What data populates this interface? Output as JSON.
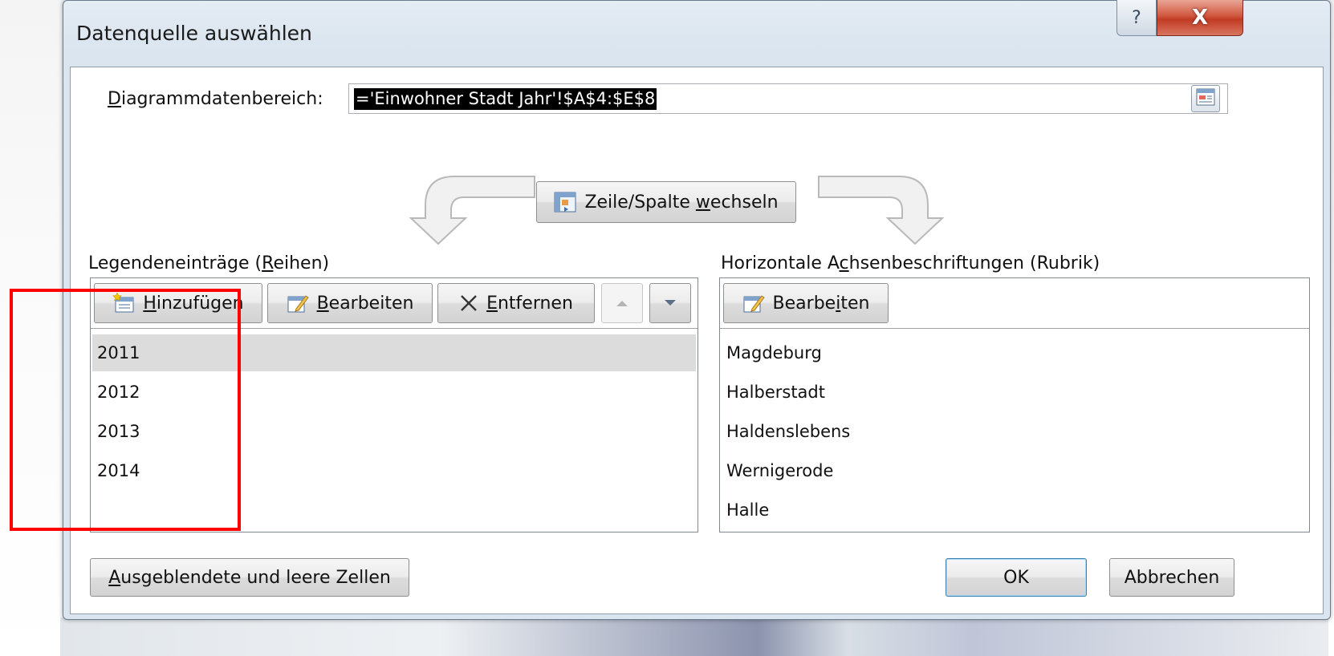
{
  "window": {
    "title": "Datenquelle auswählen",
    "help_glyph": "?",
    "close_glyph": "X"
  },
  "range": {
    "label_pre": "",
    "label_u": "D",
    "label_post": "iagrammdatenbereich:",
    "value": "='Einwohner Stadt Jahr'!$A$4:$E$8"
  },
  "switch_button": {
    "pre": "Zeile/Spalte ",
    "u": "w",
    "post": "echseln"
  },
  "legend": {
    "heading_pre": "Legendeneinträge (",
    "heading_u": "R",
    "heading_post": "eihen)",
    "add_u": "H",
    "add_post": "inzufügen",
    "edit_u": "B",
    "edit_post": "earbeiten",
    "remove_u": "E",
    "remove_post": "ntfernen",
    "items": [
      "2011",
      "2012",
      "2013",
      "2014"
    ]
  },
  "axis": {
    "heading_pre": "Horizontale A",
    "heading_u": "c",
    "heading_post": "hsenbeschriftungen (Rubrik)",
    "edit_pre": "Bearbe",
    "edit_u": "i",
    "edit_post": "ten",
    "items": [
      "Magdeburg",
      "Halberstadt",
      "Haldenslebens",
      "Wernigerode",
      "Halle"
    ]
  },
  "footer": {
    "hidden_u": "A",
    "hidden_post": "usgeblendete und leere Zellen",
    "ok": "OK",
    "cancel": "Abbrechen"
  },
  "colors": {
    "highlight": "#ff0000",
    "dialog_bg": "#dbe5ef",
    "close_red": "#c13b24"
  },
  "icons": [
    "help-icon",
    "close-icon",
    "collapse-dialog-icon",
    "switch-row-column-icon",
    "add-series-icon",
    "edit-icon",
    "remove-x-icon",
    "arrow-up-icon",
    "arrow-down-icon"
  ]
}
